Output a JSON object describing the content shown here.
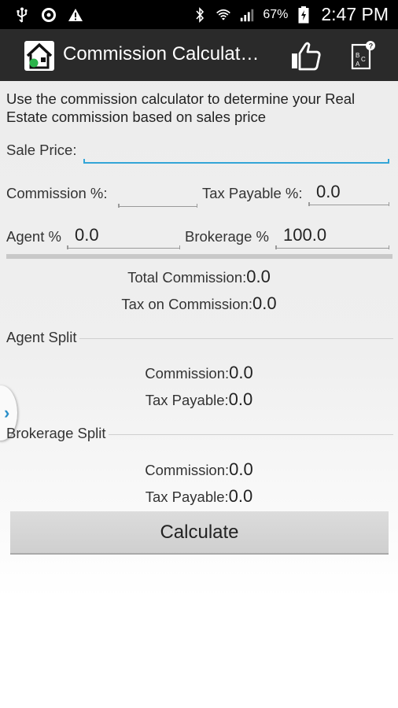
{
  "status_bar": {
    "icons_left": [
      "usb-icon",
      "sync-icon",
      "warning-icon"
    ],
    "icons_right": [
      "bluetooth-icon",
      "wifi-icon",
      "signal-icon",
      "battery-charging-icon"
    ],
    "battery_percent": "67%",
    "time": "2:47 PM"
  },
  "action_bar": {
    "title": "Commission Calculat…",
    "background": "#2a2a2a"
  },
  "intro_text": "Use the commission calculator to determine your Real Estate commission based on sales price",
  "form": {
    "sale_price_label": "Sale Price:",
    "sale_price_value": "",
    "commission_pct_label": "Commission %:",
    "commission_pct_value": "",
    "tax_payable_pct_label": "Tax Payable %:",
    "tax_payable_pct_value": "0.0",
    "agent_pct_label": "Agent %",
    "agent_pct_value": "0.0",
    "brokerage_pct_label": "Brokerage %",
    "brokerage_pct_value": "100.0"
  },
  "totals": {
    "total_commission_label": "Total Commission:",
    "total_commission_value": "0.0",
    "tax_on_commission_label": "Tax on Commission:",
    "tax_on_commission_value": "0.0"
  },
  "agent_split": {
    "header": "Agent Split",
    "commission_label": "Commission:",
    "commission_value": "0.0",
    "tax_payable_label": "Tax Payable:",
    "tax_payable_value": "0.0"
  },
  "brokerage_split": {
    "header": "Brokerage Split",
    "commission_label": "Commission:",
    "commission_value": "0.0",
    "tax_payable_label": "Tax Payable:",
    "tax_payable_value": "0.0"
  },
  "calculate_label": "Calculate",
  "colors": {
    "focus_accent": "#33a5d7",
    "drawer_chevron": "#2a8fc9",
    "app_icon_green": "#2bb34a"
  }
}
